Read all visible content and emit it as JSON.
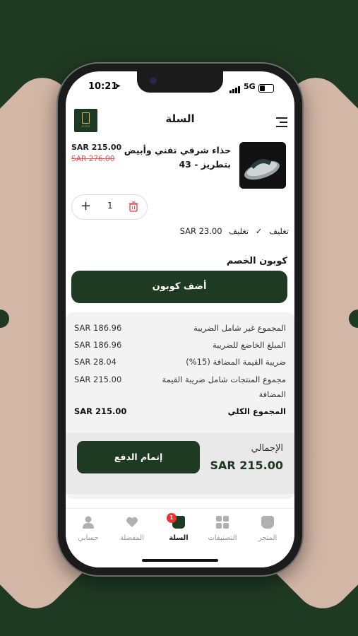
{
  "status": {
    "time": "10:21",
    "network": "5G"
  },
  "header": {
    "title": "السلة",
    "logo_text": "OUD"
  },
  "cart_item": {
    "name": "حذاء شرقي تفني وأبيض بتطريز - 43",
    "price": "SAR 215.00",
    "old_price": "SAR 276.00",
    "quantity": "1",
    "wrap_label": "تغليف",
    "wrap_option": "تغليف",
    "wrap_price": "SAR 23.00"
  },
  "coupon": {
    "title": "كوبون الخصم",
    "button": "أضف كوبون"
  },
  "summary": {
    "rows": [
      {
        "label": "المجموع غير شامل الضريبة",
        "value": "SAR 186.96"
      },
      {
        "label": "المبلغ الخاضع للضريبة",
        "value": "SAR 186.96"
      },
      {
        "label": "ضريبة القيمة المضافة (15%)",
        "value": "SAR 28.04"
      },
      {
        "label": "مجموع المنتجات شامل ضريبة القيمة المضافة",
        "value": "SAR 215.00"
      },
      {
        "label": "المجموع الكلي",
        "value": "SAR 215.00"
      }
    ]
  },
  "checkout": {
    "total_label": "الإجمالي",
    "total_value": "SAR 215.00",
    "pay_button": "إتمام الدفع"
  },
  "tabs": [
    {
      "label": "المتجر",
      "icon": "store-icon"
    },
    {
      "label": "التصنيفات",
      "icon": "categories-icon"
    },
    {
      "label": "السلة",
      "icon": "cart-icon",
      "badge": "1"
    },
    {
      "label": "المفضلة",
      "icon": "heart-icon"
    },
    {
      "label": "حسابي",
      "icon": "user-icon"
    }
  ],
  "colors": {
    "brand": "#1f3a22",
    "sale": "#e05a5a",
    "badge": "#e8352f"
  }
}
